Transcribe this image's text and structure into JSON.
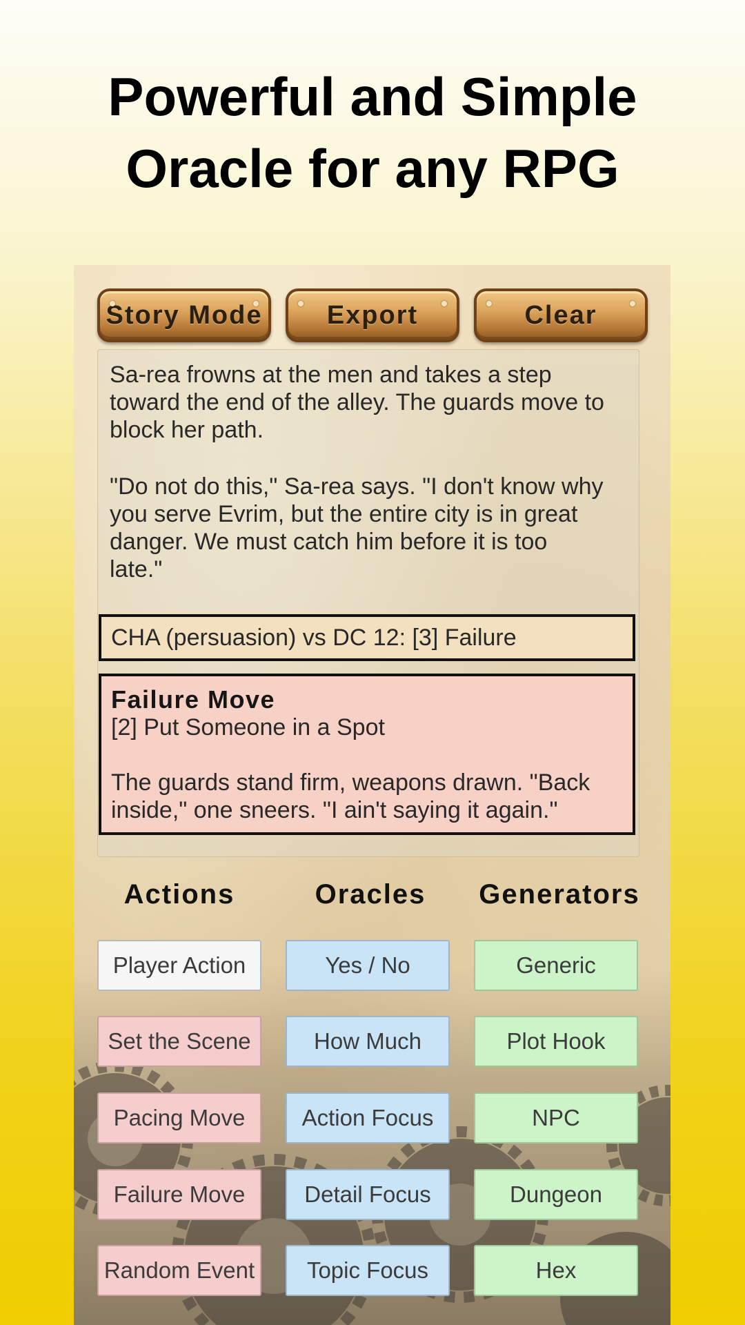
{
  "headline": {
    "line1": "Powerful and Simple",
    "line2": "Oracle for any RPG"
  },
  "toolbar": {
    "story_mode_label": "Story Mode",
    "export_label": "Export",
    "clear_label": "Clear"
  },
  "story": {
    "paragraph1": "Sa-rea frowns at the men and takes a step\ntoward the end of the alley.  The guards move to\nblock her path.",
    "paragraph2": "\"Do not do this,\" Sa-rea says.  \"I don't know why\nyou serve Evrim, but the entire city is in great\ndanger.  We must catch him before it is too\nlate.\"",
    "roll_result": "CHA (persuasion) vs DC 12: [3] Failure",
    "move_title": "Failure Move",
    "move_result": "[2] Put Someone in a Spot",
    "move_text": "The guards stand firm, weapons drawn.  \"Back\ninside,\" one sneers.  \"I ain't saying it again.\""
  },
  "columns": {
    "actions": {
      "heading": "Actions",
      "buttons": [
        "Player Action",
        "Set the Scene",
        "Pacing Move",
        "Failure Move",
        "Random Event"
      ]
    },
    "oracles": {
      "heading": "Oracles",
      "buttons": [
        "Yes / No",
        "How Much",
        "Action Focus",
        "Detail Focus",
        "Topic Focus"
      ]
    },
    "generators": {
      "heading": "Generators",
      "buttons": [
        "Generic",
        "Plot Hook",
        "NPC",
        "Dungeon",
        "Hex"
      ]
    }
  },
  "colors": {
    "action_primary": "#f6f6f6",
    "action": "#f5cdcd",
    "oracle": "#c9e4f6",
    "generator": "#cdf4c8",
    "brass": "#d9a059"
  }
}
